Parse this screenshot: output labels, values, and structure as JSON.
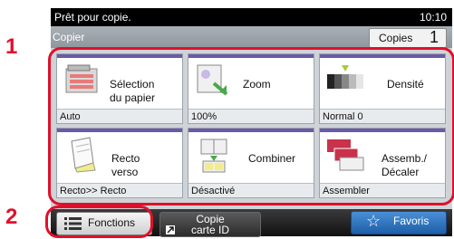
{
  "callouts": {
    "one": "1",
    "two": "2"
  },
  "status": {
    "message": "Prêt pour copie.",
    "time": "10:10"
  },
  "header": {
    "title": "Copier",
    "copies_label": "Copies",
    "copies_count": "1"
  },
  "tiles": [
    {
      "label1": "Sélection",
      "label2": "du papier",
      "value": "Auto",
      "icon": "paper-tray-icon"
    },
    {
      "label1": "Zoom",
      "label2": "",
      "value": "100%",
      "icon": "zoom-icon"
    },
    {
      "label1": "Densité",
      "label2": "",
      "value": "Normal 0",
      "icon": "density-icon"
    },
    {
      "label1": "Recto",
      "label2": "verso",
      "value": "Recto>> Recto",
      "icon": "duplex-icon"
    },
    {
      "label1": "Combiner",
      "label2": "",
      "value": "Désactivé",
      "icon": "combine-icon"
    },
    {
      "label1": "Assemb./",
      "label2": "Décaler",
      "value": "Assembler",
      "icon": "collate-icon"
    }
  ],
  "bottom": {
    "functions_label": "Fonctions",
    "id_copy_line1": "Copie",
    "id_copy_line2": "carte ID",
    "favorites_label": "Favoris"
  },
  "colors": {
    "accent_red": "#e0102a",
    "tile_bar": "#6a5aa6"
  }
}
